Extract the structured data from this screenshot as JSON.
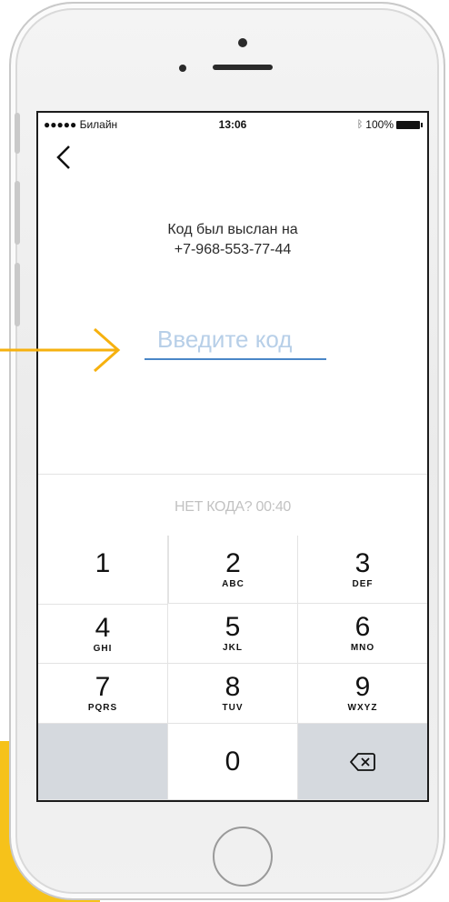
{
  "status_bar": {
    "carrier": "●●●●● Билайн",
    "time": "13:06",
    "battery": "100%"
  },
  "screen": {
    "sent_line1": "Код был выслан на",
    "sent_line2": "+7-968-553-77-44",
    "code_placeholder": "Введите код",
    "code_value": "",
    "resend_text": "НЕТ КОДА? 00:40"
  },
  "keypad": [
    {
      "num": "1",
      "letters": ""
    },
    {
      "num": "2",
      "letters": "ABC"
    },
    {
      "num": "3",
      "letters": "DEF"
    },
    {
      "num": "4",
      "letters": "GHI"
    },
    {
      "num": "5",
      "letters": "JKL"
    },
    {
      "num": "6",
      "letters": "MNO"
    },
    {
      "num": "7",
      "letters": "PQRS"
    },
    {
      "num": "8",
      "letters": "TUV"
    },
    {
      "num": "9",
      "letters": "WXYZ"
    },
    {
      "num": "",
      "letters": ""
    },
    {
      "num": "0",
      "letters": ""
    },
    {
      "num": "",
      "letters": ""
    }
  ],
  "icons": {
    "back": "chevron-left-icon",
    "delete": "backspace-icon",
    "bluetooth": "bluetooth-icon",
    "battery": "battery-icon",
    "arrow": "arrow-right-icon"
  },
  "colors": {
    "accent_yellow": "#f6c21a",
    "input_underline": "#4a86c7",
    "keypad_gray": "#d5d9de"
  }
}
